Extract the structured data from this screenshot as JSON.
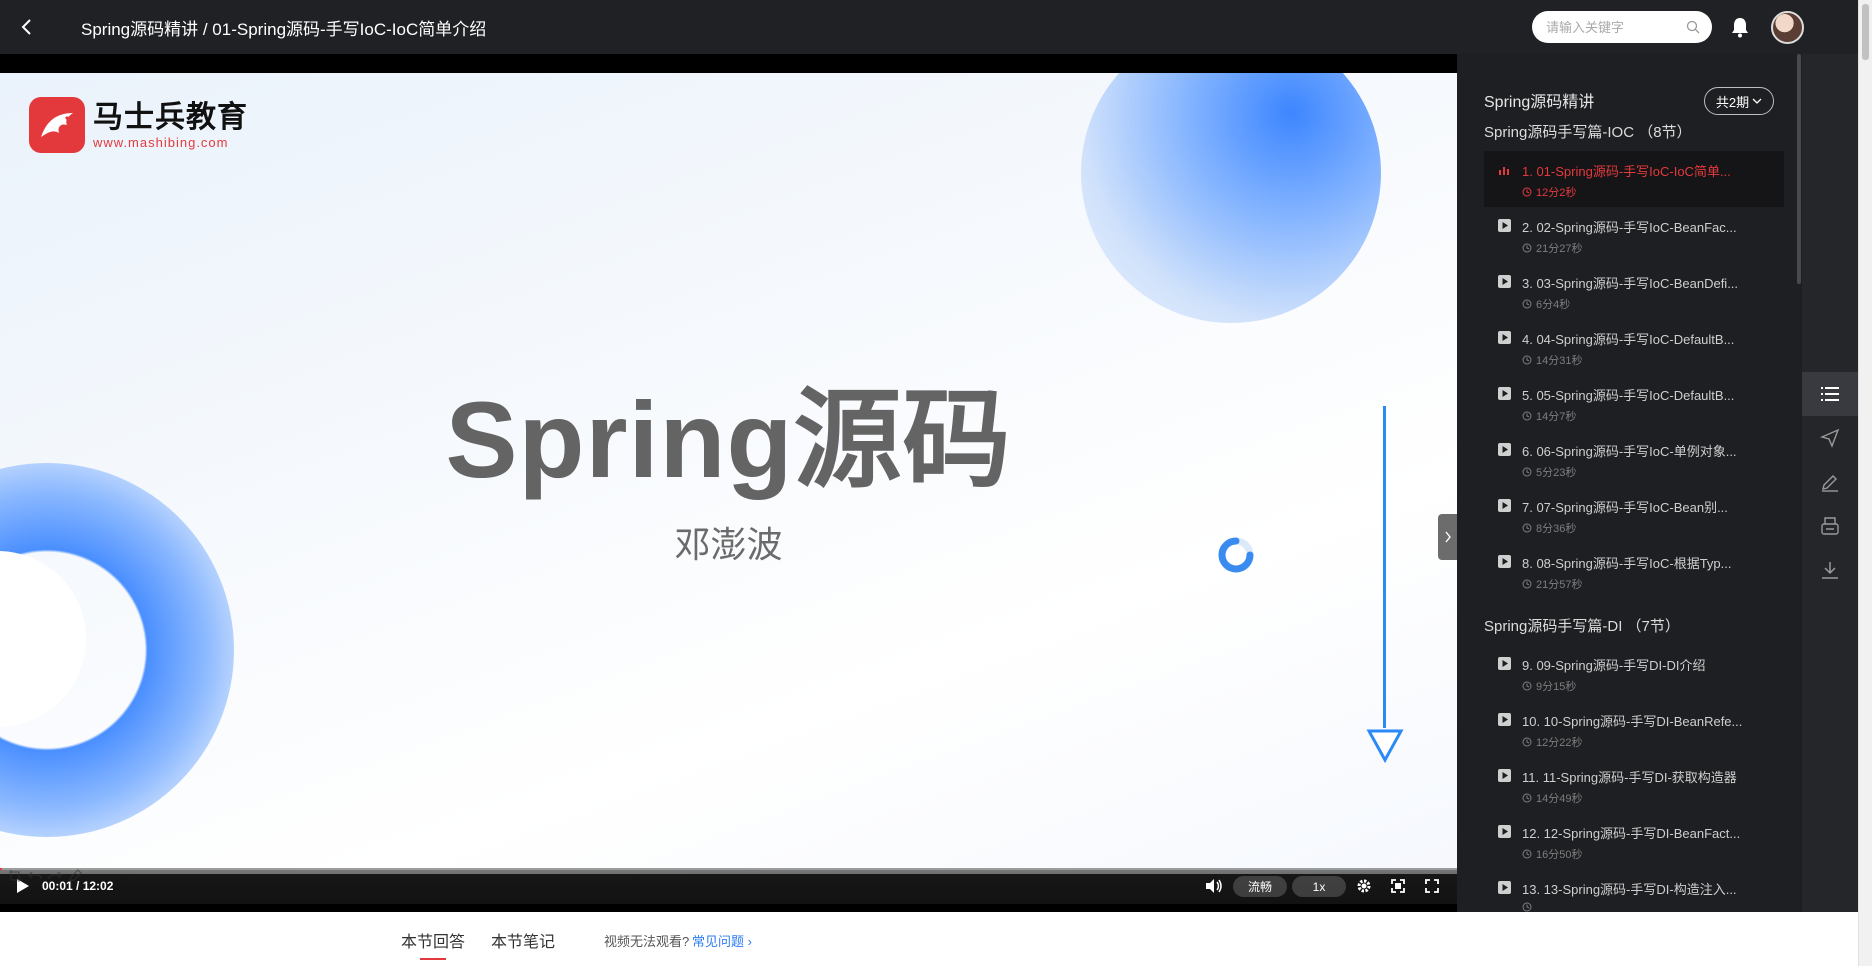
{
  "header": {
    "title": "Spring源码精讲 / 01-Spring源码-手写IoC-IoC简单介绍",
    "search_placeholder": "请输入关键字"
  },
  "slide": {
    "logo_name": "马士兵教育",
    "logo_url": "www.mashibing.com",
    "title": "Spring源码",
    "author": "邓澎波"
  },
  "player": {
    "time": "00:01 / 12:02",
    "quality": "流畅",
    "speed": "1x",
    "progress_fraction": 0.0014
  },
  "playlist": {
    "course_title": "Spring源码精讲",
    "total_label": "共2期",
    "sections": [
      {
        "title": "Spring源码手写篇-IOC （8节）",
        "lessons": [
          {
            "title": "1. 01-Spring源码-手写IoC-IoC简单...",
            "duration": "12分2秒",
            "active": true
          },
          {
            "title": "2. 02-Spring源码-手写IoC-BeanFac...",
            "duration": "21分27秒"
          },
          {
            "title": "3. 03-Spring源码-手写IoC-BeanDefi...",
            "duration": "6分4秒"
          },
          {
            "title": "4. 04-Spring源码-手写IoC-DefaultB...",
            "duration": "14分31秒"
          },
          {
            "title": "5. 05-Spring源码-手写IoC-DefaultB...",
            "duration": "14分7秒"
          },
          {
            "title": "6. 06-Spring源码-手写IoC-单例对象...",
            "duration": "5分23秒"
          },
          {
            "title": "7. 07-Spring源码-手写IoC-Bean别...",
            "duration": "8分36秒"
          },
          {
            "title": "8. 08-Spring源码-手写IoC-根据Typ...",
            "duration": "21分57秒"
          }
        ]
      },
      {
        "title": "Spring源码手写篇-DI （7节）",
        "lessons": [
          {
            "title": "9. 09-Spring源码-手写DI-DI介绍",
            "duration": "9分15秒"
          },
          {
            "title": "10. 10-Spring源码-手写DI-BeanRefe...",
            "duration": "12分22秒"
          },
          {
            "title": "11. 11-Spring源码-手写DI-获取构造器",
            "duration": "14分49秒"
          },
          {
            "title": "12. 12-Spring源码-手写DI-BeanFact...",
            "duration": "16分50秒"
          },
          {
            "title": "13. 13-Spring源码-手写DI-构造注入...",
            "duration": ""
          }
        ]
      }
    ]
  },
  "rail": {
    "icons": [
      "list-icon",
      "send-icon",
      "edit-icon",
      "inbox-icon",
      "download-icon"
    ]
  },
  "tabs": {
    "qa": "本节回答",
    "notes": "本节笔记",
    "help_text": "视频无法观看?",
    "help_link": "常见问题 ›"
  },
  "colors": {
    "accent": "#e4393c",
    "link": "#2b7cf3",
    "panel_bg": "#1e1f22",
    "header_bg": "#202124"
  }
}
